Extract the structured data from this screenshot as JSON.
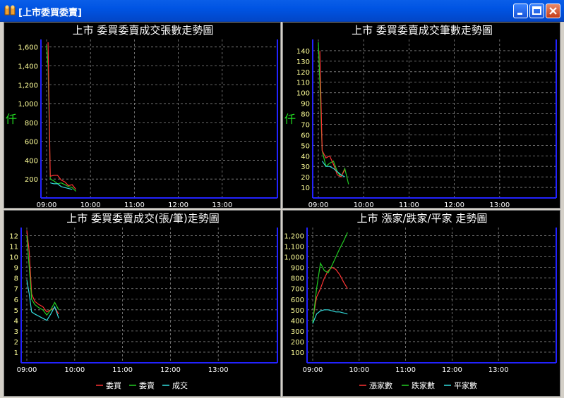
{
  "window": {
    "title": "[上市委買委賣]",
    "icon": "app-chart-icon",
    "buttons": {
      "minimize": "minimize-icon",
      "maximize": "maximize-icon",
      "close": "close-icon"
    }
  },
  "colors": {
    "bid": "#ff3333",
    "ask": "#22cc22",
    "deal": "#33dddd",
    "axis": "#2222ff",
    "grid": "#888888",
    "ytick": "#ffff99"
  },
  "chart_data": [
    {
      "type": "line",
      "title": "上市  委買委賣成交張數走勢圖",
      "ylabel": "仟",
      "xlabel": "",
      "x_ticks": [
        "09:00",
        "10:00",
        "11:00",
        "12:00",
        "13:00"
      ],
      "x_range_minutes": [
        0,
        300
      ],
      "ylim": [
        0,
        1650
      ],
      "y_ticks": [
        "200",
        "400",
        "600",
        "800",
        "1,000",
        "1,200",
        "1,400",
        "1,600"
      ],
      "y_tick_values": [
        200,
        400,
        600,
        800,
        1000,
        1200,
        1400,
        1600
      ],
      "grid": true,
      "series": [
        {
          "color_key": "ask",
          "x": [
            0,
            2,
            5,
            10,
            15,
            20,
            25,
            30,
            35,
            40
          ],
          "y": [
            1620,
            1400,
            200,
            180,
            150,
            160,
            140,
            120,
            110,
            70
          ]
        },
        {
          "color_key": "bid",
          "x": [
            2,
            5,
            10,
            15,
            20,
            25,
            30,
            35,
            40
          ],
          "y": [
            1650,
            230,
            240,
            240,
            190,
            170,
            130,
            140,
            90
          ]
        },
        {
          "color_key": "deal",
          "x": [
            5,
            10,
            15,
            20,
            25,
            30,
            35
          ],
          "y": [
            160,
            150,
            150,
            120,
            110,
            100,
            90
          ]
        }
      ]
    },
    {
      "type": "line",
      "title": "上市  委買委賣成交筆數走勢圖",
      "ylabel": "仟",
      "xlabel": "",
      "x_ticks": [
        "09:00",
        "10:00",
        "11:00",
        "12:00",
        "13:00"
      ],
      "x_range_minutes": [
        0,
        300
      ],
      "ylim": [
        0,
        148
      ],
      "y_ticks": [
        "10",
        "20",
        "30",
        "40",
        "50",
        "60",
        "70",
        "80",
        "90",
        "100",
        "110",
        "120",
        "130",
        "140"
      ],
      "y_tick_values": [
        10,
        20,
        30,
        40,
        50,
        60,
        70,
        80,
        90,
        100,
        110,
        120,
        130,
        140
      ],
      "grid": true,
      "series": [
        {
          "color_key": "ask",
          "x": [
            0,
            2,
            5,
            10,
            15,
            20,
            25,
            30,
            35,
            40
          ],
          "y": [
            148,
            110,
            45,
            30,
            33,
            35,
            25,
            20,
            28,
            13
          ]
        },
        {
          "color_key": "bid",
          "x": [
            2,
            5,
            10,
            15,
            20,
            25,
            30,
            35
          ],
          "y": [
            140,
            45,
            38,
            40,
            32,
            22,
            20,
            27
          ]
        },
        {
          "color_key": "deal",
          "x": [
            5,
            10,
            15,
            20,
            25,
            30,
            35
          ],
          "y": [
            35,
            30,
            30,
            28,
            25,
            22,
            20
          ]
        }
      ]
    },
    {
      "type": "line",
      "title": "上市  委買委賣成交(張/筆)走勢圖",
      "ylabel": "",
      "xlabel": "",
      "x_ticks": [
        "09:00",
        "10:00",
        "11:00",
        "12:00",
        "13:00"
      ],
      "x_range_minutes": [
        0,
        300
      ],
      "ylim": [
        0,
        12.5
      ],
      "y_ticks": [
        "1",
        "2",
        "3",
        "4",
        "5",
        "6",
        "7",
        "8",
        "9",
        "10",
        "11",
        "12"
      ],
      "y_tick_values": [
        1,
        2,
        3,
        4,
        5,
        6,
        7,
        8,
        9,
        10,
        11,
        12
      ],
      "grid": true,
      "legend": [
        "委買",
        "委賣",
        "成交"
      ],
      "legend_position": "bottom",
      "series": [
        {
          "name": "委買",
          "color_key": "bid",
          "x": [
            0,
            3,
            6,
            10,
            15,
            20,
            25,
            30,
            35,
            40
          ],
          "y": [
            12.5,
            10.5,
            6.5,
            5.8,
            5.5,
            5.3,
            4.8,
            5.0,
            5.2,
            4.6
          ]
        },
        {
          "name": "委賣",
          "color_key": "ask",
          "x": [
            0,
            3,
            6,
            10,
            15,
            20,
            25,
            30,
            35,
            40
          ],
          "y": [
            12.0,
            9.0,
            6.0,
            5.5,
            5.2,
            5.0,
            4.5,
            5.0,
            5.7,
            5.0
          ]
        },
        {
          "name": "成交",
          "color_key": "deal",
          "x": [
            0,
            3,
            6,
            10,
            15,
            20,
            25,
            30,
            35,
            40
          ],
          "y": [
            7.8,
            6.5,
            4.8,
            4.6,
            4.4,
            4.2,
            4.0,
            4.6,
            5.3,
            4.2
          ]
        }
      ]
    },
    {
      "type": "line",
      "title": "上市  漲家/跌家/平家  走勢圖",
      "ylabel": "",
      "xlabel": "",
      "x_ticks": [
        "09:00",
        "10:00",
        "11:00",
        "12:00",
        "13:00"
      ],
      "x_range_minutes": [
        0,
        300
      ],
      "ylim": [
        0,
        1250
      ],
      "y_ticks": [
        "100",
        "200",
        "300",
        "400",
        "500",
        "600",
        "700",
        "800",
        "900",
        "1,000",
        "1,100",
        "1,200"
      ],
      "y_tick_values": [
        100,
        200,
        300,
        400,
        500,
        600,
        700,
        800,
        900,
        1000,
        1100,
        1200
      ],
      "grid": true,
      "legend": [
        "漲家數",
        "跌家數",
        "平家數"
      ],
      "legend_position": "bottom",
      "series": [
        {
          "name": "漲家數",
          "color_key": "bid",
          "x": [
            0,
            5,
            10,
            15,
            20,
            25,
            30,
            35,
            40,
            45
          ],
          "y": [
            400,
            620,
            700,
            800,
            870,
            900,
            880,
            830,
            760,
            700
          ]
        },
        {
          "name": "跌家數",
          "color_key": "ask",
          "x": [
            0,
            5,
            10,
            15,
            20,
            25,
            30,
            35,
            40,
            45
          ],
          "y": [
            380,
            700,
            940,
            870,
            850,
            920,
            1000,
            1080,
            1150,
            1230
          ]
        },
        {
          "name": "平家數",
          "color_key": "deal",
          "x": [
            0,
            5,
            10,
            15,
            20,
            25,
            30,
            35,
            40,
            45
          ],
          "y": [
            370,
            460,
            490,
            500,
            500,
            490,
            480,
            480,
            470,
            460
          ]
        }
      ]
    }
  ]
}
